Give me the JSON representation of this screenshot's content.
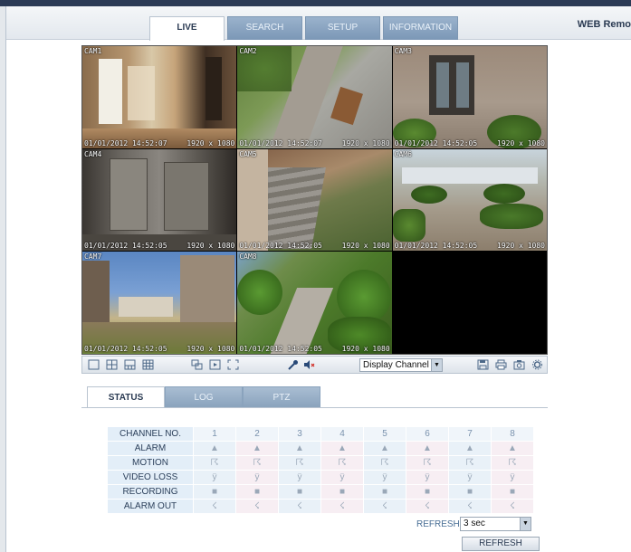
{
  "nav": {
    "tabs": [
      {
        "label": "LIVE",
        "active": true
      },
      {
        "label": "SEARCH",
        "active": false
      },
      {
        "label": "SETUP",
        "active": false
      },
      {
        "label": "INFORMATION",
        "active": false
      }
    ],
    "brand": "WEB Remo"
  },
  "cameras": [
    {
      "label": "CAM1",
      "timestamp": "01/01/2012 14:52:07",
      "resolution": "1920 x 1080"
    },
    {
      "label": "CAM2",
      "timestamp": "01/01/2012 14:52:07",
      "resolution": "1920 x 1080"
    },
    {
      "label": "CAM3",
      "timestamp": "01/01/2012 14:52:05",
      "resolution": "1920 x 1080"
    },
    {
      "label": "CAM4",
      "timestamp": "01/01/2012 14:52:05",
      "resolution": "1920 x 1080"
    },
    {
      "label": "CAM5",
      "timestamp": "01/01/2012 14:52:05",
      "resolution": "1920 x 1080"
    },
    {
      "label": "CAM6",
      "timestamp": "01/01/2012 14:52:05",
      "resolution": "1920 x 1080"
    },
    {
      "label": "CAM7",
      "timestamp": "01/01/2012 14:52:05",
      "resolution": "1920 x 1080"
    },
    {
      "label": "CAM8",
      "timestamp": "01/01/2012 14:52:05",
      "resolution": "1920 x 1080"
    }
  ],
  "toolbar": {
    "display_select": "Display Channel",
    "icons": [
      "single-view-icon",
      "quad-view-icon",
      "split-view-icon",
      "nine-view-icon",
      "sequence-icon",
      "fullscreen-icon",
      "zoom-icon",
      "color-picker-icon",
      "audio-icon",
      "save-icon",
      "print-icon",
      "capture-icon",
      "settings-icon"
    ]
  },
  "subtabs": [
    {
      "label": "STATUS",
      "active": true
    },
    {
      "label": "LOG",
      "active": false
    },
    {
      "label": "PTZ",
      "active": false
    }
  ],
  "status_table": {
    "header_label": "CHANNEL NO.",
    "channels": [
      "1",
      "2",
      "3",
      "4",
      "5",
      "6",
      "7",
      "8"
    ],
    "rows": [
      {
        "label": "ALARM",
        "glyph": "▲"
      },
      {
        "label": "MOTION",
        "glyph": "☈"
      },
      {
        "label": "VIDEO LOSS",
        "glyph": "ÿ"
      },
      {
        "label": "RECORDING",
        "glyph": "■"
      },
      {
        "label": "ALARM OUT",
        "glyph": "☇"
      }
    ]
  },
  "refresh": {
    "label": "REFRESH",
    "interval": "3 sec",
    "button": "REFRESH"
  }
}
